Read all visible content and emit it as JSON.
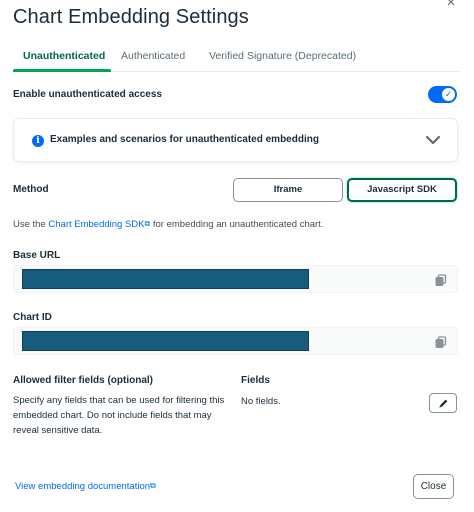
{
  "dialog": {
    "title": "Chart Embedding Settings",
    "close_glyph": "×"
  },
  "tabs": [
    {
      "label": "Unauthenticated",
      "active": true
    },
    {
      "label": "Authenticated",
      "active": false
    },
    {
      "label": "Verified Signature (Deprecated)",
      "active": false
    }
  ],
  "unauth_access": {
    "label": "Enable unauthenticated access",
    "enabled": true,
    "check_glyph": "✓"
  },
  "examples": {
    "info_glyph": "i",
    "label": "Examples and scenarios for unauthenticated embedding"
  },
  "method": {
    "label": "Method",
    "options": [
      "Iframe",
      "Javascript SDK"
    ],
    "selected": "Javascript SDK"
  },
  "help": {
    "prefix": "Use the ",
    "link": "Chart Embedding SDK",
    "ext_glyph": "⧉",
    "suffix": " for embedding an unauthenticated chart."
  },
  "base_url": {
    "label": "Base URL",
    "value": ""
  },
  "chart_id": {
    "label": "Chart ID",
    "value": ""
  },
  "filters": {
    "label": "Allowed filter fields (optional)",
    "description": "Specify any fields that can be used for filtering this embedded chart. Do not include fields that may reveal sensitive data.",
    "fields_label": "Fields",
    "fields_value": "No fields."
  },
  "footer": {
    "doc_link": "View embedding documentation",
    "close_label": "Close"
  },
  "colors": {
    "brand_green": "#00684a",
    "accent_blue": "#016bf8",
    "redaction": "#175b7d"
  }
}
